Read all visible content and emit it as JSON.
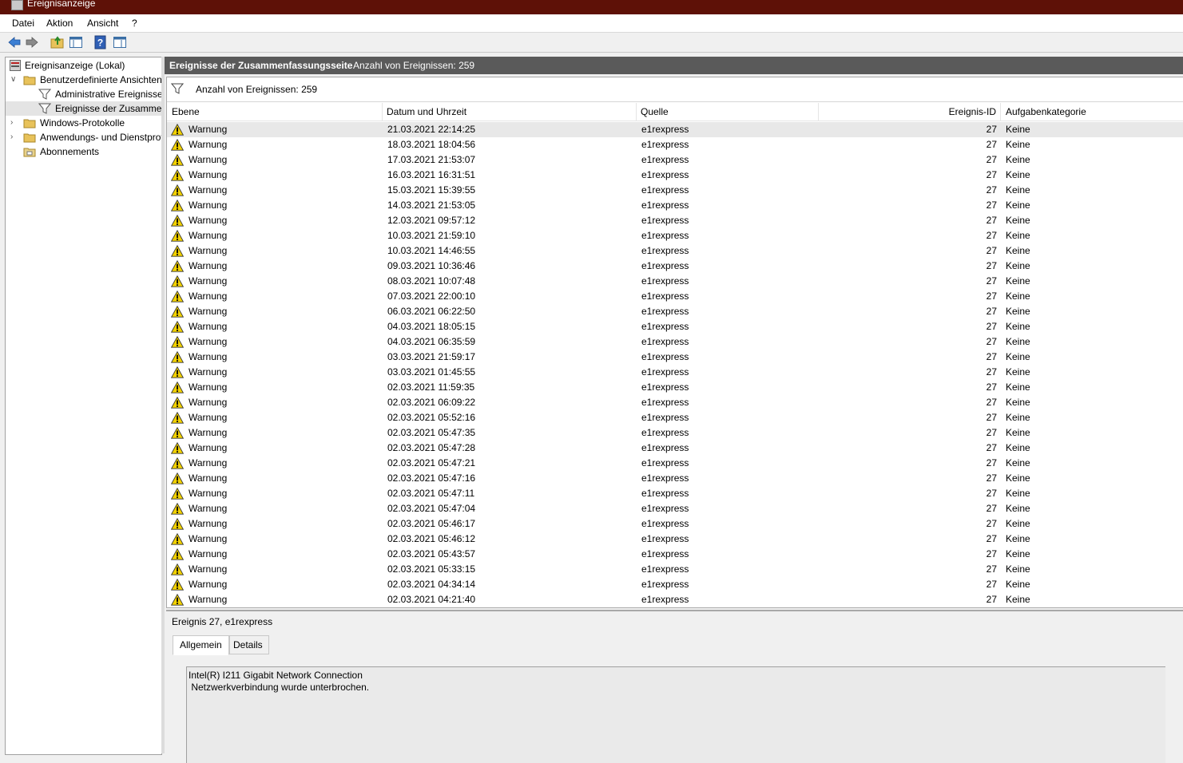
{
  "window": {
    "title": "Ereignisanzeige",
    "icon": "event-viewer-icon"
  },
  "menu": [
    "Datei",
    "Aktion",
    "Ansicht",
    "?"
  ],
  "toolbar": [
    "back-arrow-icon",
    "forward-arrow-icon",
    "folder-up-icon",
    "show-hide-tree-icon",
    "help-icon",
    "show-hide-action-icon"
  ],
  "tree": {
    "items": [
      {
        "label": "Ereignisanzeige (Lokal)",
        "icon": "event-viewer-icon"
      },
      {
        "label": "Benutzerdefinierte Ansichten",
        "icon": "folder-icon",
        "expanded": true
      },
      {
        "label": "Administrative Ereignisse",
        "icon": "filter-icon"
      },
      {
        "label": "Ereignisse der Zusammenfassungsseite",
        "icon": "filter-icon",
        "selected": true
      },
      {
        "label": "Windows-Protokolle",
        "icon": "folder-icon"
      },
      {
        "label": "Anwendungs- und Dienstprotokolle",
        "icon": "folder-icon"
      },
      {
        "label": "Abonnements",
        "icon": "subscription-icon"
      }
    ]
  },
  "main": {
    "header_title": "Ereignisse der Zusammenfassungsseite",
    "header_count": "Anzahl von Ereignissen: 259",
    "filter_text": "Anzahl von Ereignissen: 259",
    "columns": [
      "Ebene",
      "Datum und Uhrzeit",
      "Quelle",
      "Ereignis-ID",
      "Aufgabenkategorie"
    ],
    "rows": [
      [
        "Warnung",
        "21.03.2021 22:14:25",
        "e1rexpress",
        "27",
        "Keine"
      ],
      [
        "Warnung",
        "18.03.2021 18:04:56",
        "e1rexpress",
        "27",
        "Keine"
      ],
      [
        "Warnung",
        "17.03.2021 21:53:07",
        "e1rexpress",
        "27",
        "Keine"
      ],
      [
        "Warnung",
        "16.03.2021 16:31:51",
        "e1rexpress",
        "27",
        "Keine"
      ],
      [
        "Warnung",
        "15.03.2021 15:39:55",
        "e1rexpress",
        "27",
        "Keine"
      ],
      [
        "Warnung",
        "14.03.2021 21:53:05",
        "e1rexpress",
        "27",
        "Keine"
      ],
      [
        "Warnung",
        "12.03.2021 09:57:12",
        "e1rexpress",
        "27",
        "Keine"
      ],
      [
        "Warnung",
        "10.03.2021 21:59:10",
        "e1rexpress",
        "27",
        "Keine"
      ],
      [
        "Warnung",
        "10.03.2021 14:46:55",
        "e1rexpress",
        "27",
        "Keine"
      ],
      [
        "Warnung",
        "09.03.2021 10:36:46",
        "e1rexpress",
        "27",
        "Keine"
      ],
      [
        "Warnung",
        "08.03.2021 10:07:48",
        "e1rexpress",
        "27",
        "Keine"
      ],
      [
        "Warnung",
        "07.03.2021 22:00:10",
        "e1rexpress",
        "27",
        "Keine"
      ],
      [
        "Warnung",
        "06.03.2021 06:22:50",
        "e1rexpress",
        "27",
        "Keine"
      ],
      [
        "Warnung",
        "04.03.2021 18:05:15",
        "e1rexpress",
        "27",
        "Keine"
      ],
      [
        "Warnung",
        "04.03.2021 06:35:59",
        "e1rexpress",
        "27",
        "Keine"
      ],
      [
        "Warnung",
        "03.03.2021 21:59:17",
        "e1rexpress",
        "27",
        "Keine"
      ],
      [
        "Warnung",
        "03.03.2021 01:45:55",
        "e1rexpress",
        "27",
        "Keine"
      ],
      [
        "Warnung",
        "02.03.2021 11:59:35",
        "e1rexpress",
        "27",
        "Keine"
      ],
      [
        "Warnung",
        "02.03.2021 06:09:22",
        "e1rexpress",
        "27",
        "Keine"
      ],
      [
        "Warnung",
        "02.03.2021 05:52:16",
        "e1rexpress",
        "27",
        "Keine"
      ],
      [
        "Warnung",
        "02.03.2021 05:47:35",
        "e1rexpress",
        "27",
        "Keine"
      ],
      [
        "Warnung",
        "02.03.2021 05:47:28",
        "e1rexpress",
        "27",
        "Keine"
      ],
      [
        "Warnung",
        "02.03.2021 05:47:21",
        "e1rexpress",
        "27",
        "Keine"
      ],
      [
        "Warnung",
        "02.03.2021 05:47:16",
        "e1rexpress",
        "27",
        "Keine"
      ],
      [
        "Warnung",
        "02.03.2021 05:47:11",
        "e1rexpress",
        "27",
        "Keine"
      ],
      [
        "Warnung",
        "02.03.2021 05:47:04",
        "e1rexpress",
        "27",
        "Keine"
      ],
      [
        "Warnung",
        "02.03.2021 05:46:17",
        "e1rexpress",
        "27",
        "Keine"
      ],
      [
        "Warnung",
        "02.03.2021 05:46:12",
        "e1rexpress",
        "27",
        "Keine"
      ],
      [
        "Warnung",
        "02.03.2021 05:43:57",
        "e1rexpress",
        "27",
        "Keine"
      ],
      [
        "Warnung",
        "02.03.2021 05:33:15",
        "e1rexpress",
        "27",
        "Keine"
      ],
      [
        "Warnung",
        "02.03.2021 04:34:14",
        "e1rexpress",
        "27",
        "Keine"
      ],
      [
        "Warnung",
        "02.03.2021 04:21:40",
        "e1rexpress",
        "27",
        "Keine"
      ]
    ]
  },
  "detail": {
    "title": "Ereignis 27, e1rexpress",
    "tabs": [
      "Allgemein",
      "Details"
    ],
    "description_line1": "Intel(R) I211 Gigabit Network Connection",
    "description_line2": " Netzwerkverbindung wurde unterbrochen."
  },
  "colors": {
    "titlebar": "#5e1107",
    "header": "#5a5a5a",
    "warning": "#f2d100"
  }
}
